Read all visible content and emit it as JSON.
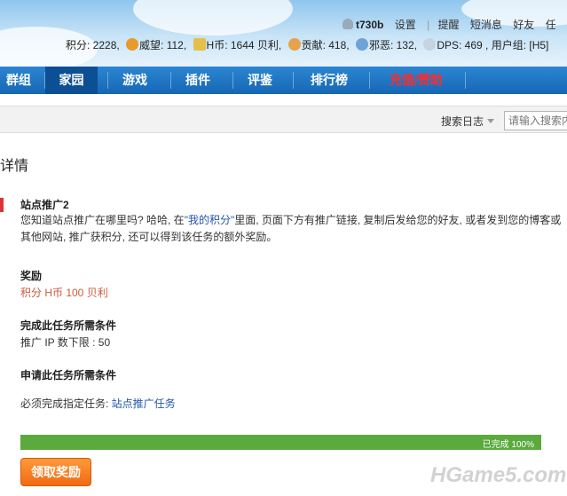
{
  "header": {
    "username": "t730b",
    "links": [
      "设置",
      "提醒",
      "短消息",
      "好友",
      "任"
    ],
    "stats": [
      {
        "label": "积分: 2228",
        "icon": ""
      },
      {
        "label": "威望: 112",
        "icon": "crown-icon"
      },
      {
        "label": "H币: 1644 贝利",
        "icon": "coin-icon"
      },
      {
        "label": "贡献: 418",
        "icon": "heart-icon"
      },
      {
        "label": "邪恶: 132",
        "icon": "cloud-icon"
      },
      {
        "label": "DPS: 469 , 用户组: [H5]",
        "icon": "star-icon"
      }
    ],
    "colors": {
      "sky": "#8fc6ee"
    }
  },
  "nav": {
    "items": [
      "群组",
      "家园",
      "游戏",
      "插件",
      "评鉴",
      "排行榜",
      "充值/赞助"
    ],
    "active": "家园",
    "colors": {
      "bar": "#1666b4",
      "active": "#0d4f94",
      "highlight": "#ff2b2b"
    }
  },
  "search": {
    "label": "搜索日志",
    "placeholder": "请输入搜索内容"
  },
  "page": {
    "heading": "详情"
  },
  "task": {
    "title": "站点推广2",
    "desc_before": "您知道站点推广在哪里吗? 哈哈, 在",
    "desc_link": "\"我的积分\"",
    "desc_after": "里面, 页面下方有推广链接, 复制后发给您的好友, 或者发到您的博客或其他网站, 推广获积分, 还可以得到该任务的额外奖励。",
    "reward_heading": "奖励",
    "reward_value": "积分 H币 100 贝利",
    "complete_heading": "完成此任务所需条件",
    "complete_value": "推广 IP 数下限 : 50",
    "apply_heading": "申请此任务所需条件",
    "apply_prefix": "必须完成指定任务: ",
    "apply_link": "站点推广任务",
    "progress_label": "已完成 100%",
    "progress_value": 100,
    "claim_button": "领取奖励"
  },
  "watermark": "HGame5.com"
}
